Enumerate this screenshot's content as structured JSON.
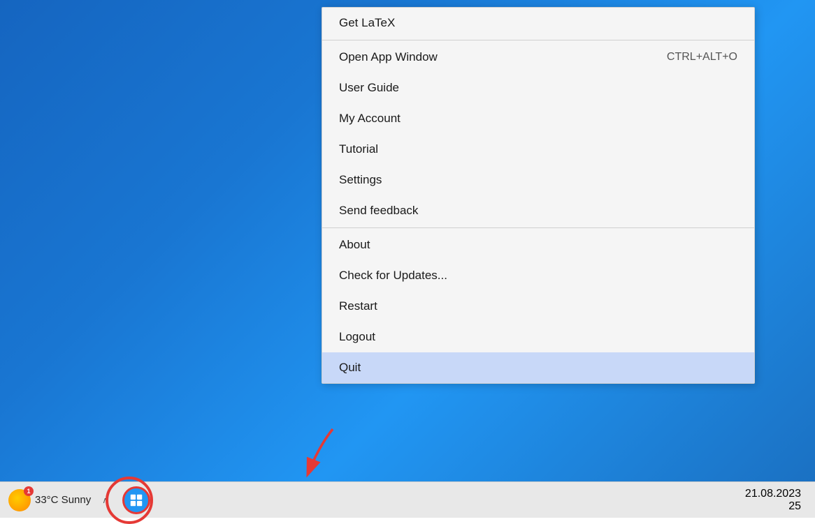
{
  "desktop": {
    "background": "blue gradient"
  },
  "context_menu": {
    "items": [
      {
        "id": "get-latex",
        "label": "Get LaTeX",
        "shortcut": "",
        "divider_after": true
      },
      {
        "id": "open-app-window",
        "label": "Open App Window",
        "shortcut": "CTRL+ALT+O",
        "divider_after": false
      },
      {
        "id": "user-guide",
        "label": "User Guide",
        "shortcut": "",
        "divider_after": false
      },
      {
        "id": "my-account",
        "label": "My Account",
        "shortcut": "",
        "divider_after": false
      },
      {
        "id": "tutorial",
        "label": "Tutorial",
        "shortcut": "",
        "divider_after": false
      },
      {
        "id": "settings",
        "label": "Settings",
        "shortcut": "",
        "divider_after": false
      },
      {
        "id": "send-feedback",
        "label": "Send feedback",
        "shortcut": "",
        "divider_after": true
      },
      {
        "id": "about",
        "label": "About",
        "shortcut": "",
        "divider_after": false
      },
      {
        "id": "check-updates",
        "label": "Check for Updates...",
        "shortcut": "",
        "divider_after": false
      },
      {
        "id": "restart",
        "label": "Restart",
        "shortcut": "",
        "divider_after": false
      },
      {
        "id": "logout",
        "label": "Logout",
        "shortcut": "",
        "divider_after": false
      },
      {
        "id": "quit",
        "label": "Quit",
        "shortcut": "",
        "divider_after": false,
        "highlighted": true
      }
    ]
  },
  "taskbar": {
    "weather_badge": "1",
    "temperature": "33°C  Sunny",
    "expand_icon": "∧",
    "date": "21.08.2023",
    "time_number": "25"
  }
}
